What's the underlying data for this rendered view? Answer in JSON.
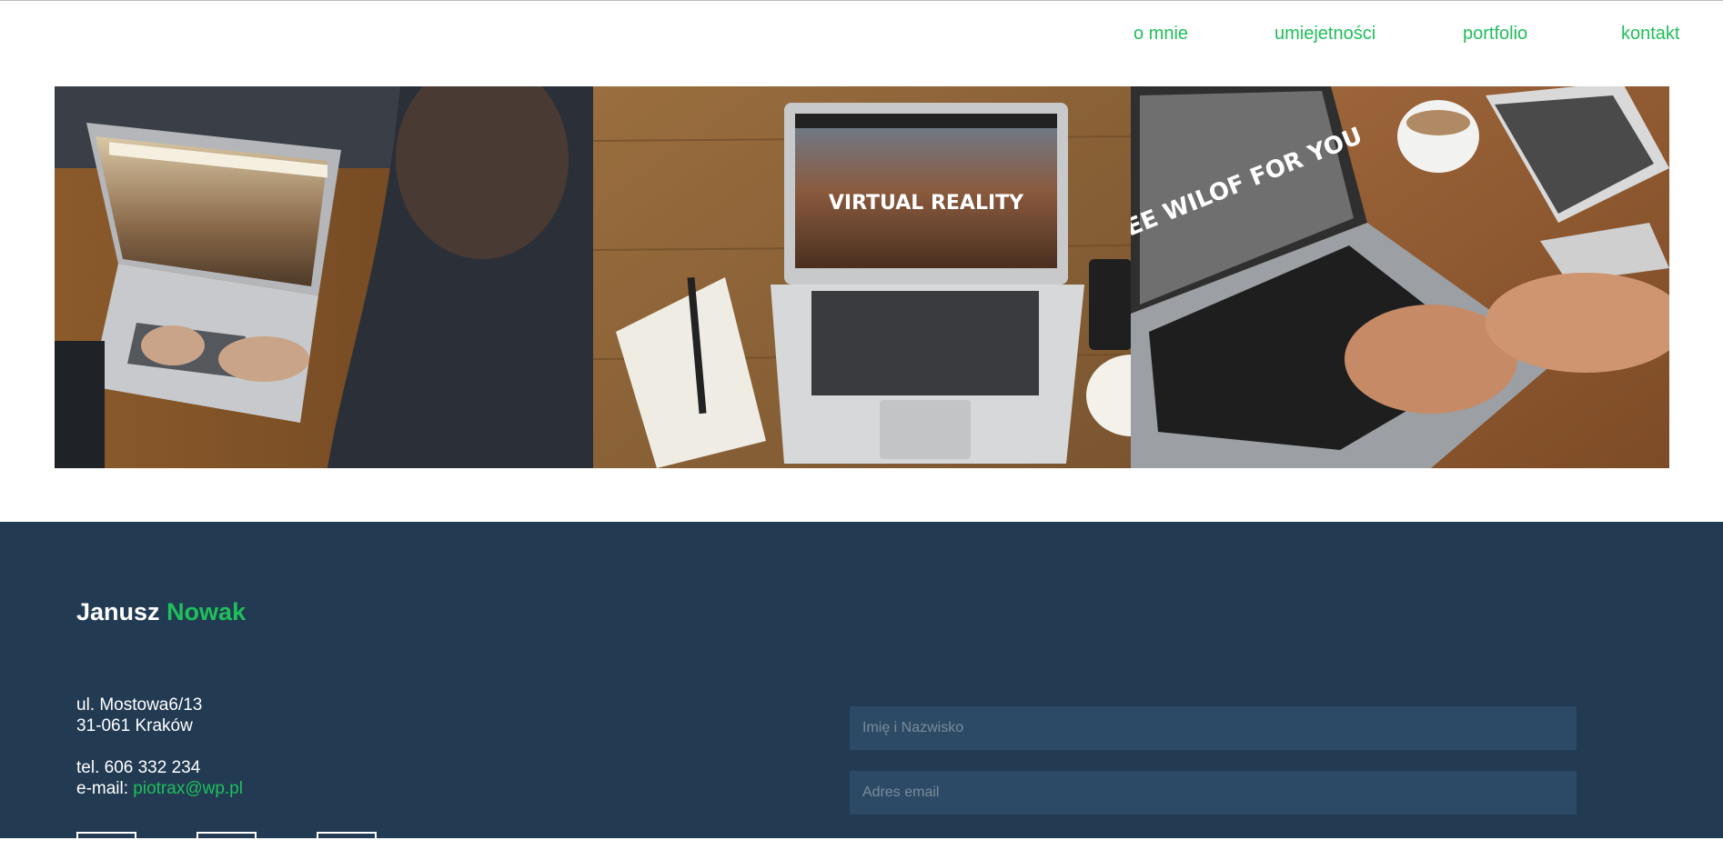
{
  "nav": {
    "items": [
      {
        "label": "o mnie"
      },
      {
        "label": "umiejetności"
      },
      {
        "label": "portfolio"
      },
      {
        "label": "kontakt"
      }
    ]
  },
  "gallery": {
    "photos": [
      {
        "screen_text": ""
      },
      {
        "screen_text": "VIRTUAL REALITY"
      },
      {
        "screen_text": "FREE WILOF FOR YOU"
      }
    ]
  },
  "footer": {
    "brand": {
      "first": "Janusz",
      "last": "Nowak"
    },
    "address_line1": "ul. Mostowa6/13",
    "address_line2": "31-061 Kraków",
    "phone": "tel. 606 332 234",
    "email_label": "e-mail: ",
    "email": "piotrax@wp.pl"
  },
  "form": {
    "name_placeholder": "Imię i Nazwisko",
    "email_placeholder": "Adres email"
  },
  "colors": {
    "accent": "#1fbf5a",
    "footer_bg": "#223b53",
    "field_bg": "#2c4a66"
  }
}
